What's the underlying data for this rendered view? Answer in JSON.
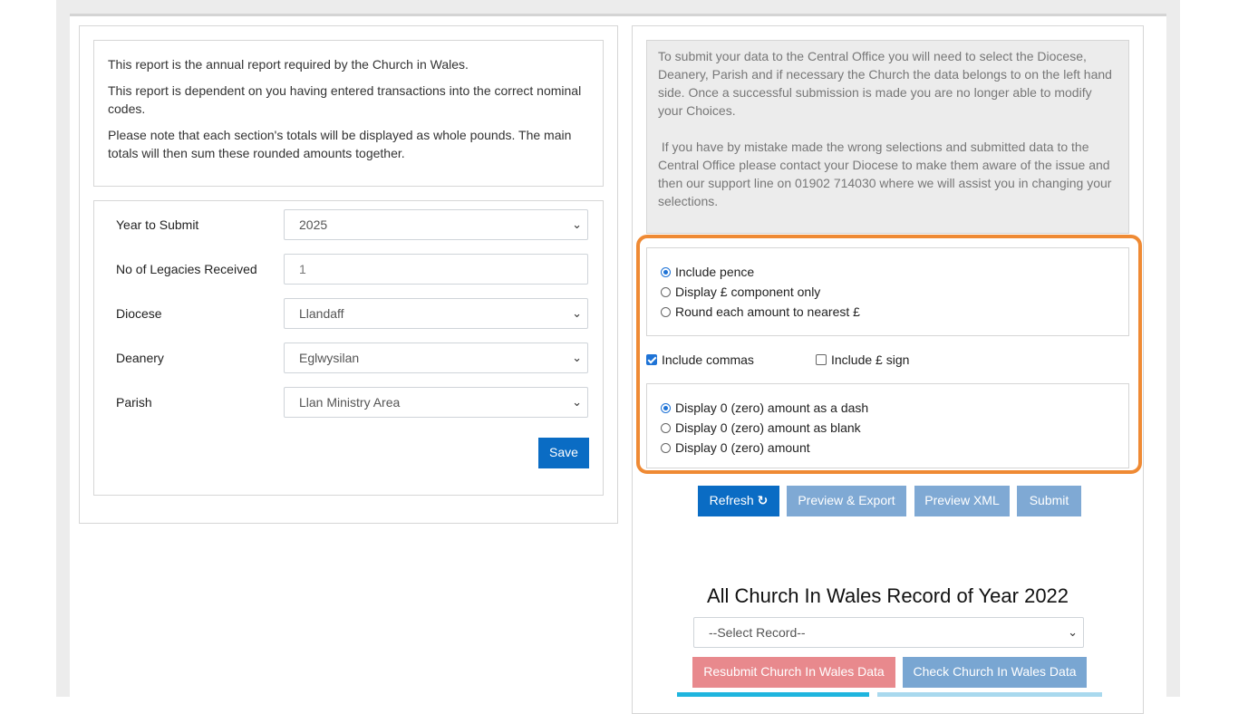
{
  "info": {
    "line1": "This report is the annual report required by the Church in Wales.",
    "line2": "This report is dependent on you having entered transactions into the correct nominal codes.",
    "line3": "Please note that each section's totals will be displayed as whole pounds. The main totals will then sum these rounded amounts together."
  },
  "form": {
    "year_label": "Year to Submit",
    "year_value": "2025",
    "legacies_label": "No of Legacies Received",
    "legacies_value": "1",
    "diocese_label": "Diocese",
    "diocese_value": "Llandaff",
    "deanery_label": "Deanery",
    "deanery_value": "Eglwysilan",
    "parish_label": "Parish",
    "parish_value": "Llan Ministry Area",
    "save_label": "Save"
  },
  "notice": {
    "para1": "To submit your data to the Central Office  you will need to select the Diocese, Deanery, Parish and if necessary the Church the data belongs to on the left hand side. Once a successful submission is made you are no longer able to modify your Choices.",
    "para2": " If you have by mistake made the wrong selections and submitted data to the Central Office please contact your Diocese to make them aware of the issue and then our support line on 01902 714030 where we will assist you in changing your selections."
  },
  "options": {
    "pence_group": [
      {
        "label": "Include pence",
        "checked": true
      },
      {
        "label": "Display £ component only",
        "checked": false
      },
      {
        "label": "Round each amount to nearest £",
        "checked": false
      }
    ],
    "include_commas": {
      "label": "Include commas",
      "checked": true
    },
    "include_pound": {
      "label": "Include £ sign",
      "checked": false
    },
    "zero_group": [
      {
        "label": "Display 0 (zero) amount as a dash",
        "checked": true
      },
      {
        "label": "Display 0 (zero) amount as blank",
        "checked": false
      },
      {
        "label": "Display 0 (zero) amount",
        "checked": false
      }
    ]
  },
  "actions": {
    "refresh": "Refresh",
    "preview_export": "Preview & Export",
    "preview_xml": "Preview XML",
    "submit": "Submit"
  },
  "records": {
    "title": "All Church In Wales Record of Year 2022",
    "select_placeholder": "--Select Record--",
    "resubmit": "Resubmit Church In Wales Data",
    "check": "Check Church In Wales Data"
  },
  "colors": {
    "primary": "#0a6cc4",
    "highlight": "#ef8a34",
    "danger_muted": "#e8898d"
  },
  "icons": {
    "refresh": "refresh-icon",
    "chevron": "chevron-down-icon"
  }
}
